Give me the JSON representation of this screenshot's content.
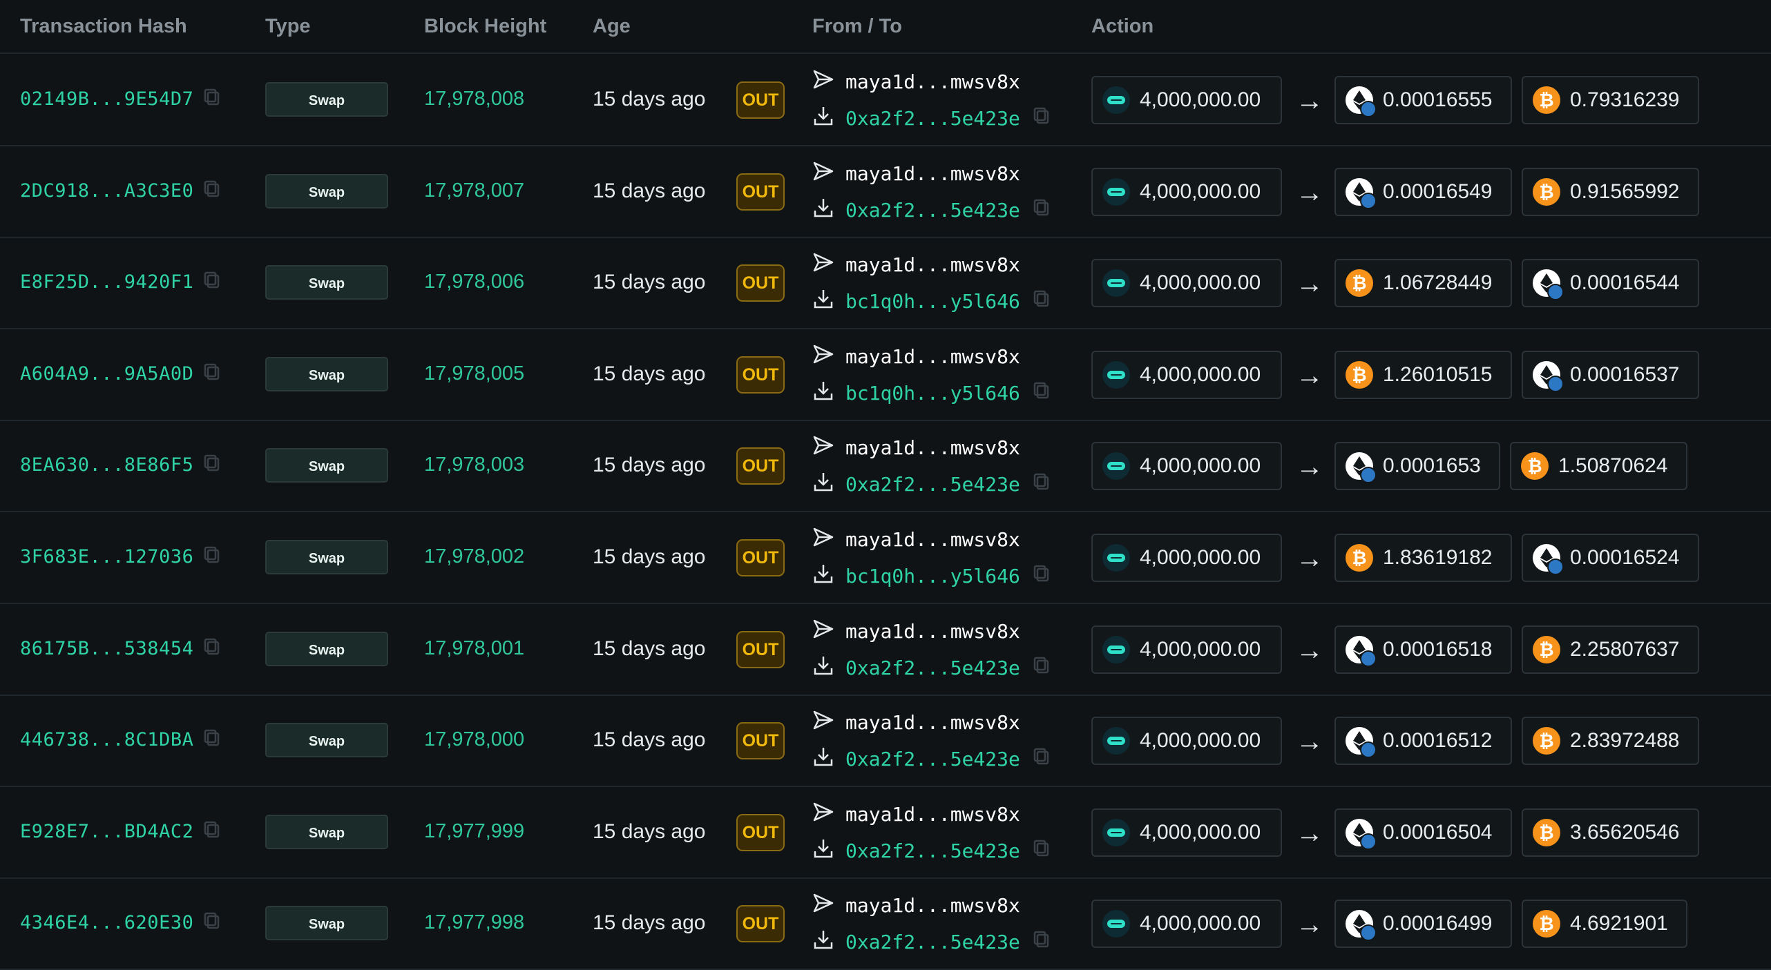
{
  "colors": {
    "background": "#0f1316",
    "accent_green": "#2fd3a6",
    "out_badge": "#f0b90b",
    "btc": "#f7931a",
    "cacao": "#2fe0c8"
  },
  "headers": {
    "hash": "Transaction Hash",
    "type": "Type",
    "block": "Block Height",
    "age": "Age",
    "from_to": "From / To",
    "action": "Action"
  },
  "rows": [
    {
      "hash": "02149B...9E54D7",
      "type": "Swap",
      "block": "17,978,008",
      "age": "15 days ago",
      "direction": "OUT",
      "from": "maya1d...mwsv8x",
      "to": "0xa2f2...5e423e",
      "in_amount": "4,000,000.00",
      "out1": {
        "icon": "eth",
        "amount": "0.00016555"
      },
      "out2": {
        "icon": "btc",
        "amount": "0.79316239"
      }
    },
    {
      "hash": "2DC918...A3C3E0",
      "type": "Swap",
      "block": "17,978,007",
      "age": "15 days ago",
      "direction": "OUT",
      "from": "maya1d...mwsv8x",
      "to": "0xa2f2...5e423e",
      "in_amount": "4,000,000.00",
      "out1": {
        "icon": "eth",
        "amount": "0.00016549"
      },
      "out2": {
        "icon": "btc",
        "amount": "0.91565992"
      }
    },
    {
      "hash": "E8F25D...9420F1",
      "type": "Swap",
      "block": "17,978,006",
      "age": "15 days ago",
      "direction": "OUT",
      "from": "maya1d...mwsv8x",
      "to": "bc1q0h...y5l646",
      "in_amount": "4,000,000.00",
      "out1": {
        "icon": "btc",
        "amount": "1.06728449"
      },
      "out2": {
        "icon": "eth",
        "amount": "0.00016544"
      }
    },
    {
      "hash": "A604A9...9A5A0D",
      "type": "Swap",
      "block": "17,978,005",
      "age": "15 days ago",
      "direction": "OUT",
      "from": "maya1d...mwsv8x",
      "to": "bc1q0h...y5l646",
      "in_amount": "4,000,000.00",
      "out1": {
        "icon": "btc",
        "amount": "1.26010515"
      },
      "out2": {
        "icon": "eth",
        "amount": "0.00016537"
      }
    },
    {
      "hash": "8EA630...8E86F5",
      "type": "Swap",
      "block": "17,978,003",
      "age": "15 days ago",
      "direction": "OUT",
      "from": "maya1d...mwsv8x",
      "to": "0xa2f2...5e423e",
      "in_amount": "4,000,000.00",
      "out1": {
        "icon": "eth",
        "amount": "0.0001653"
      },
      "out2": {
        "icon": "btc",
        "amount": "1.50870624"
      }
    },
    {
      "hash": "3F683E...127036",
      "type": "Swap",
      "block": "17,978,002",
      "age": "15 days ago",
      "direction": "OUT",
      "from": "maya1d...mwsv8x",
      "to": "bc1q0h...y5l646",
      "in_amount": "4,000,000.00",
      "out1": {
        "icon": "btc",
        "amount": "1.83619182"
      },
      "out2": {
        "icon": "eth",
        "amount": "0.00016524"
      }
    },
    {
      "hash": "86175B...538454",
      "type": "Swap",
      "block": "17,978,001",
      "age": "15 days ago",
      "direction": "OUT",
      "from": "maya1d...mwsv8x",
      "to": "0xa2f2...5e423e",
      "in_amount": "4,000,000.00",
      "out1": {
        "icon": "eth",
        "amount": "0.00016518"
      },
      "out2": {
        "icon": "btc",
        "amount": "2.25807637"
      }
    },
    {
      "hash": "446738...8C1DBA",
      "type": "Swap",
      "block": "17,978,000",
      "age": "15 days ago",
      "direction": "OUT",
      "from": "maya1d...mwsv8x",
      "to": "0xa2f2...5e423e",
      "in_amount": "4,000,000.00",
      "out1": {
        "icon": "eth",
        "amount": "0.00016512"
      },
      "out2": {
        "icon": "btc",
        "amount": "2.83972488"
      }
    },
    {
      "hash": "E928E7...BD4AC2",
      "type": "Swap",
      "block": "17,977,999",
      "age": "15 days ago",
      "direction": "OUT",
      "from": "maya1d...mwsv8x",
      "to": "0xa2f2...5e423e",
      "in_amount": "4,000,000.00",
      "out1": {
        "icon": "eth",
        "amount": "0.00016504"
      },
      "out2": {
        "icon": "btc",
        "amount": "3.65620546"
      }
    },
    {
      "hash": "4346E4...620E30",
      "type": "Swap",
      "block": "17,977,998",
      "age": "15 days ago",
      "direction": "OUT",
      "from": "maya1d...mwsv8x",
      "to": "0xa2f2...5e423e",
      "in_amount": "4,000,000.00",
      "out1": {
        "icon": "eth",
        "amount": "0.00016499"
      },
      "out2": {
        "icon": "btc",
        "amount": "4.6921901"
      }
    }
  ]
}
